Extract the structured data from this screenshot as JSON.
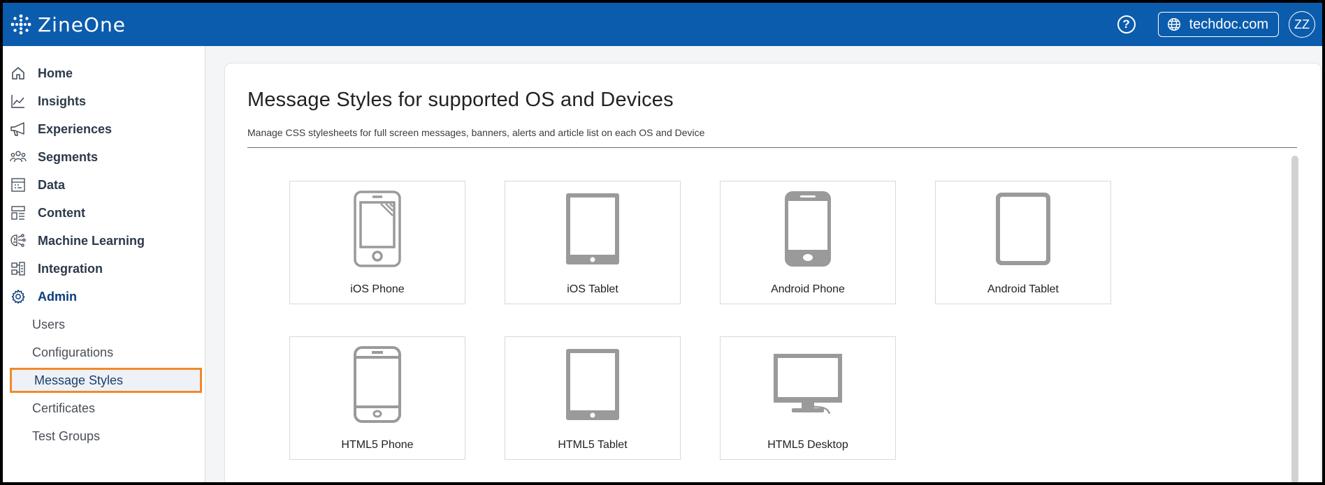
{
  "header": {
    "brand": "ZineOne",
    "domain": "techdoc.com",
    "avatar_initials": "ZZ",
    "help_glyph": "?",
    "color": "#0b5cad"
  },
  "sidebar": {
    "items": [
      {
        "label": "Home",
        "icon": "home-icon"
      },
      {
        "label": "Insights",
        "icon": "chart-line-icon"
      },
      {
        "label": "Experiences",
        "icon": "megaphone-icon"
      },
      {
        "label": "Segments",
        "icon": "people-icon"
      },
      {
        "label": "Data",
        "icon": "data-table-icon"
      },
      {
        "label": "Content",
        "icon": "layout-icon"
      },
      {
        "label": "Machine Learning",
        "icon": "brain-icon"
      },
      {
        "label": "Integration",
        "icon": "integration-icon"
      },
      {
        "label": "Admin",
        "icon": "gear-icon"
      }
    ],
    "admin_sub": [
      "Users",
      "Configurations",
      "Message Styles",
      "Certificates",
      "Test Groups"
    ],
    "selected": "Message Styles",
    "highlight_color": "#f08a2c"
  },
  "main": {
    "title": "Message Styles for supported OS and Devices",
    "subtitle": "Manage CSS stylesheets for full screen messages, banners, alerts and article list on each OS and Device",
    "tiles": [
      {
        "label": "iOS Phone",
        "icon": "ios-phone-icon"
      },
      {
        "label": "iOS Tablet",
        "icon": "ios-tablet-icon"
      },
      {
        "label": "Android Phone",
        "icon": "android-phone-icon"
      },
      {
        "label": "Android Tablet",
        "icon": "android-tablet-icon"
      },
      {
        "label": "HTML5 Phone",
        "icon": "html5-phone-icon"
      },
      {
        "label": "HTML5 Tablet",
        "icon": "html5-tablet-icon"
      },
      {
        "label": "HTML5 Desktop",
        "icon": "html5-desktop-icon"
      }
    ]
  }
}
